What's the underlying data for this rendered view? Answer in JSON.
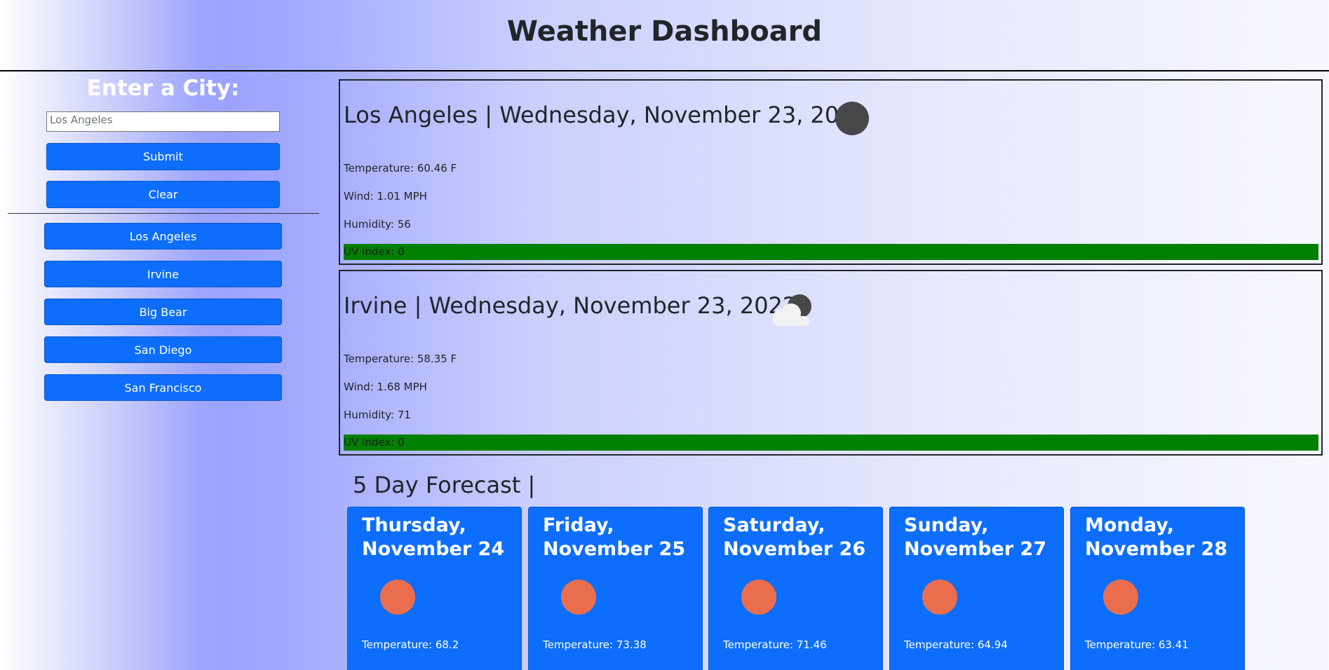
{
  "header": {
    "title": "Weather Dashboard"
  },
  "sidebar": {
    "heading": "Enter a City:",
    "input_value": "Los Angeles",
    "submit_label": "Submit",
    "clear_label": "Clear",
    "history": [
      "Los Angeles",
      "Irvine",
      "Big Bear",
      "San Diego",
      "San Francisco"
    ]
  },
  "current": [
    {
      "title": "Los Angeles | Wednesday, November 23, 2022",
      "icon": "moon-icon",
      "temperature": "Temperature: 60.46 F",
      "wind": "Wind: 1.01 MPH",
      "humidity": "Humidity: 56",
      "uv": "UV Index: 0"
    },
    {
      "title": "Irvine | Wednesday, November 23, 2022",
      "icon": "cloudy-night-icon",
      "temperature": "Temperature: 58.35 F",
      "wind": "Wind: 1.68 MPH",
      "humidity": "Humidity: 71",
      "uv": "UV Index: 0"
    }
  ],
  "forecast": {
    "title": "5 Day Forecast |",
    "days": [
      {
        "date": "Thursday, November 24",
        "icon": "sun-icon",
        "temperature": "Temperature: 68.2"
      },
      {
        "date": "Friday, November 25",
        "icon": "sun-icon",
        "temperature": "Temperature: 73.38"
      },
      {
        "date": "Saturday, November 26",
        "icon": "sun-icon",
        "temperature": "Temperature: 71.46"
      },
      {
        "date": "Sunday, November 27",
        "icon": "sun-icon",
        "temperature": "Temperature: 64.94"
      },
      {
        "date": "Monday, November 28",
        "icon": "sun-icon",
        "temperature": "Temperature: 63.41"
      }
    ]
  },
  "colors": {
    "button_primary": "#0d6efd",
    "uv_low": "#008000",
    "sun": "#ea6e4d",
    "moon": "#474749"
  }
}
